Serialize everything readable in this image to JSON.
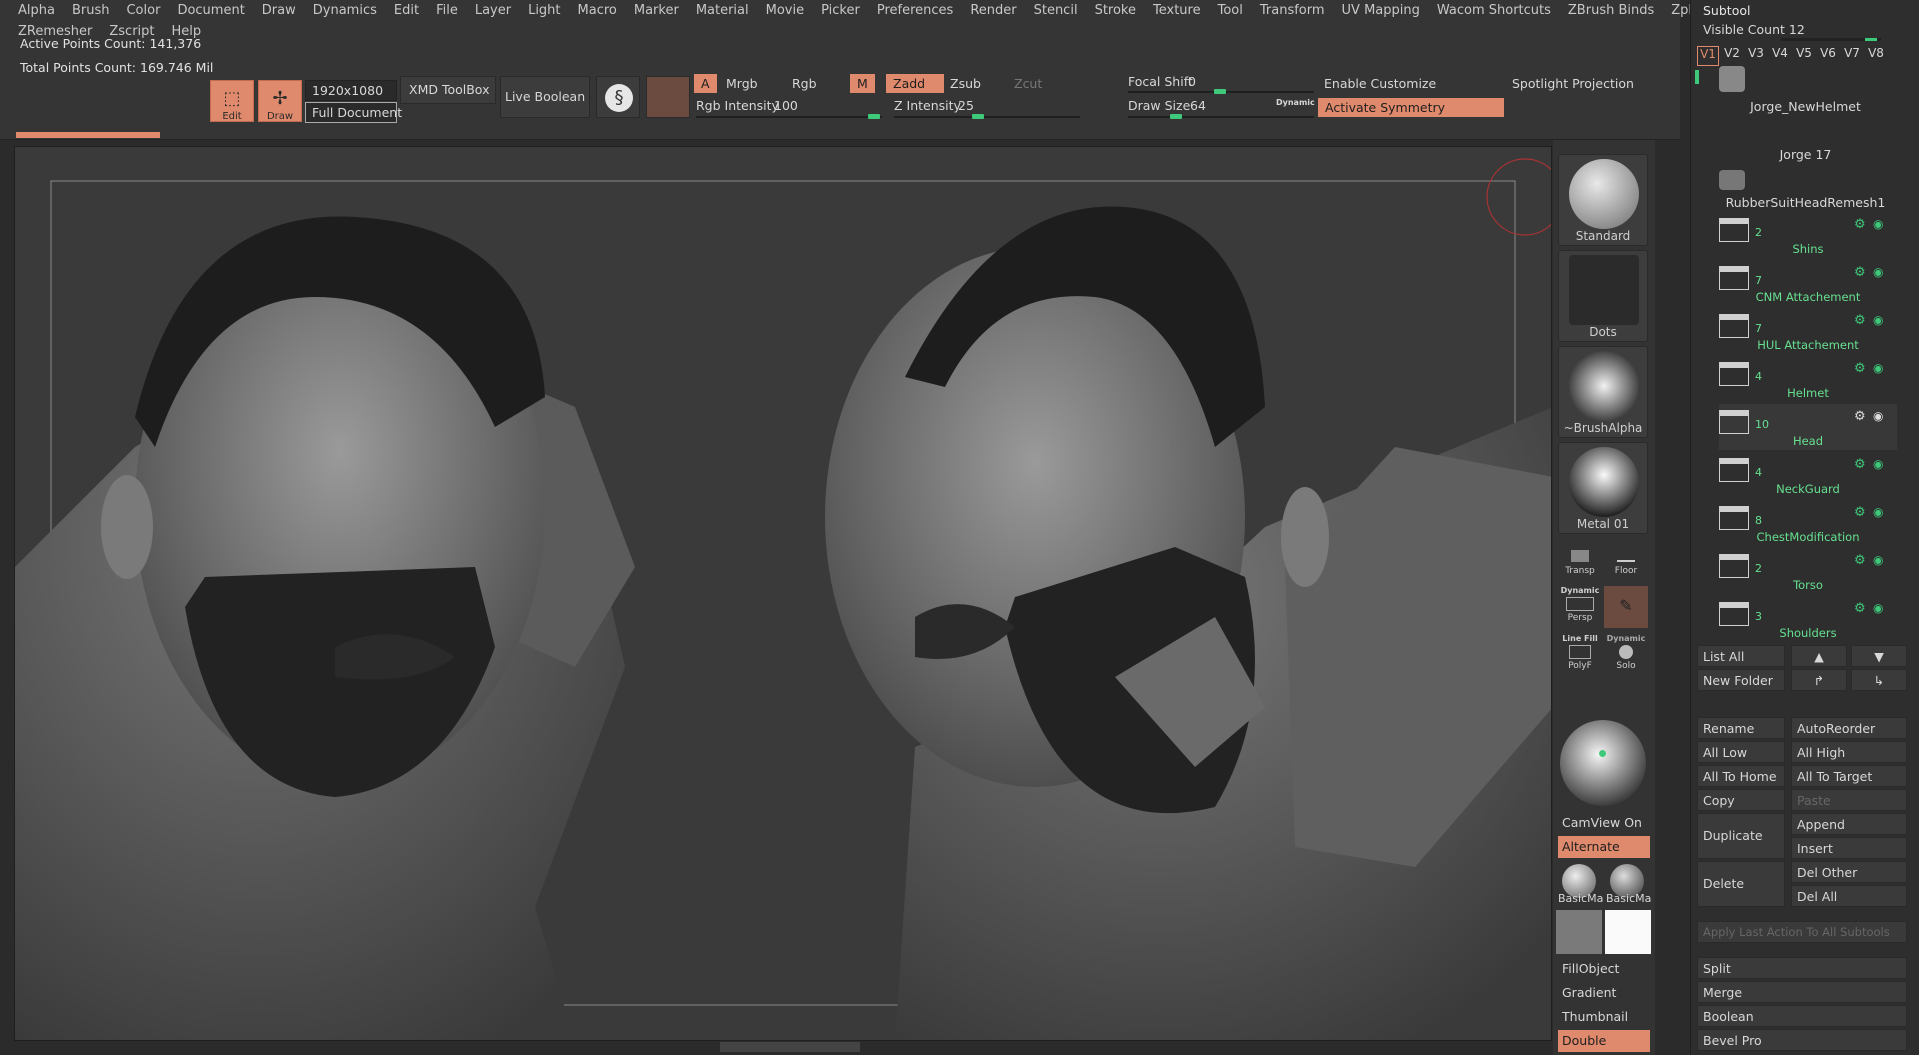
{
  "menu": [
    "Alpha",
    "Brush",
    "Color",
    "Document",
    "Draw",
    "Dynamics",
    "Edit",
    "File",
    "Layer",
    "Light",
    "Macro",
    "Marker",
    "Material",
    "Movie",
    "Picker",
    "Preferences",
    "Render",
    "Stencil",
    "Stroke",
    "Texture",
    "Tool",
    "Transform",
    "UV Mapping",
    "Wacom Shortcuts",
    "ZBrush Binds",
    "Zplugin",
    "ZRemesh"
  ],
  "menu2": [
    "ZRemesher",
    "Zscript",
    "Help"
  ],
  "info": {
    "active": "Active Points Count: 141,376",
    "total": "Total Points Count: 169.746 Mil"
  },
  "toolbar": {
    "edit": "Edit",
    "draw": "Draw",
    "resolution": "1920x1080",
    "full_document": "Full Document",
    "xmd": "XMD ToolBox",
    "live_boolean": "Live Boolean",
    "a": "A",
    "mrgb": "Mrgb",
    "rgb": "Rgb",
    "m": "M",
    "zadd": "Zadd",
    "zsub": "Zsub",
    "zcut": "Zcut",
    "rgb_intensity_label": "Rgb Intensity",
    "rgb_intensity": "100",
    "z_intensity_label": "Z Intensity",
    "z_intensity": "25",
    "focal_shift_label": "Focal Shift",
    "focal_shift": "0",
    "draw_size_label": "Draw Size",
    "draw_size": "64",
    "dynamic": "Dynamic",
    "enable_customize": "Enable Customize",
    "activate_symmetry": "Activate Symmetry",
    "spotlight": "Spotlight Projection"
  },
  "tray": {
    "brushes": [
      {
        "label": "Standard"
      },
      {
        "label": "Dots"
      },
      {
        "label": "~BrushAlpha"
      },
      {
        "label": "Metal 01"
      }
    ],
    "transp": "Transp",
    "floor": "Floor",
    "dynamic": "Dynamic",
    "persp": "Persp",
    "line_fill": "Line Fill",
    "polyf": "PolyF",
    "solo_dynamic": "Dynamic",
    "solo": "Solo",
    "camview": "CamView On",
    "alternate": "Alternate",
    "basic1": "BasicMa",
    "basic2": "BasicMa",
    "fillobject": "FillObject",
    "gradient": "Gradient",
    "thumbnail": "Thumbnail",
    "double": "Double"
  },
  "subtool": {
    "title": "Subtool",
    "visible_count": "Visible Count 12",
    "versions": [
      "V1",
      "V2",
      "V3",
      "V4",
      "V5",
      "V6",
      "V7",
      "V8"
    ],
    "meshes": [
      "Jorge_NewHelmet",
      "Jorge 17",
      "RubberSuitHeadRemesh1"
    ],
    "folders": [
      {
        "num": "2",
        "name": "Shins"
      },
      {
        "num": "7",
        "name": "CNM Attachement"
      },
      {
        "num": "7",
        "name": "HUL Attachement"
      },
      {
        "num": "4",
        "name": "Helmet"
      },
      {
        "num": "10",
        "name": "Head"
      },
      {
        "num": "4",
        "name": "NeckGuard"
      },
      {
        "num": "8",
        "name": "ChestModification"
      },
      {
        "num": "2",
        "name": "Torso"
      },
      {
        "num": "3",
        "name": "Shoulders"
      }
    ],
    "list_all": "List All",
    "new_folder": "New Folder",
    "rename": "Rename",
    "autoreorder": "AutoReorder",
    "all_low": "All Low",
    "all_high": "All High",
    "all_to_home": "All To Home",
    "all_to_target": "All To Target",
    "copy": "Copy",
    "paste": "Paste",
    "duplicate": "Duplicate",
    "append": "Append",
    "insert": "Insert",
    "delete": "Delete",
    "del_other": "Del Other",
    "del_all": "Del All",
    "apply_last": "Apply Last Action To All Subtools",
    "split": "Split",
    "merge": "Merge",
    "boolean": "Boolean",
    "bevel_pro": "Bevel Pro"
  },
  "colors": {
    "accent": "#e08a6d",
    "green": "#3ec97a",
    "bg": "#353535",
    "canvas": "#393939"
  }
}
